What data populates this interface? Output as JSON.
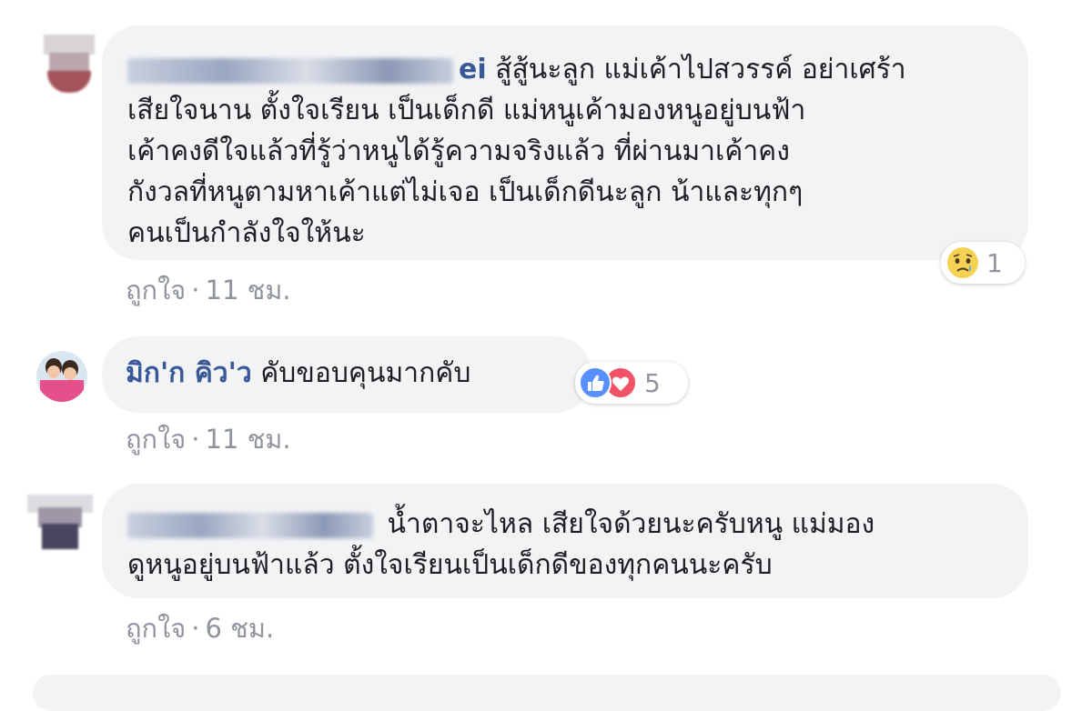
{
  "comments": [
    {
      "author_visible_tail": "ei",
      "text_lines": [
        "สู้สู้นะลูก แม่เค้าไปสวรรค์ อย่าเศร้า",
        "เสียใจนาน ตั้งใจเรียน เป็นเด็กดี แม่หนูเค้ามองหนูอยู่บนฟ้า",
        "เค้าคงดีใจแล้วที่รู้ว่าหนูได้รู้ความจริงแล้ว ที่ผ่านมาเค้าคง",
        "กังวลที่หนูตามหาเค้าแต่ไม่เจอ เป็นเด็กดีนะลูก น้าและทุกๆ",
        "คนเป็นกำลังใจให้นะ"
      ],
      "like_label": "ถูกใจ",
      "separator": "·",
      "time": "11 ชม.",
      "reaction": {
        "icon": "sad-face-icon",
        "count": "1"
      }
    },
    {
      "author": "มิก'ก คิว'ว",
      "text": "คับขอบคุนมากคับ",
      "like_label": "ถูกใจ",
      "separator": "·",
      "time": "11 ชม.",
      "reaction": {
        "icons": [
          "like-icon",
          "love-icon"
        ],
        "count": "5"
      }
    },
    {
      "text_lines": [
        "น้ำตาจะไหล เสียใจด้วยนะครับหนู แม่มอง",
        "ดูหนูอยู่บนฟ้าแล้ว ตั้งใจเรียนเป็นเด็กดีของทุกคนนะครับ"
      ],
      "like_label": "ถูกใจ",
      "separator": "·",
      "time": "6 ชม."
    }
  ],
  "colors": {
    "author": "#385898",
    "bubble": "#f2f3f5",
    "meta": "#90949c",
    "like_blue": "#5890ff",
    "love_red": "#f25268",
    "sad_yellow": "#f7d154"
  }
}
